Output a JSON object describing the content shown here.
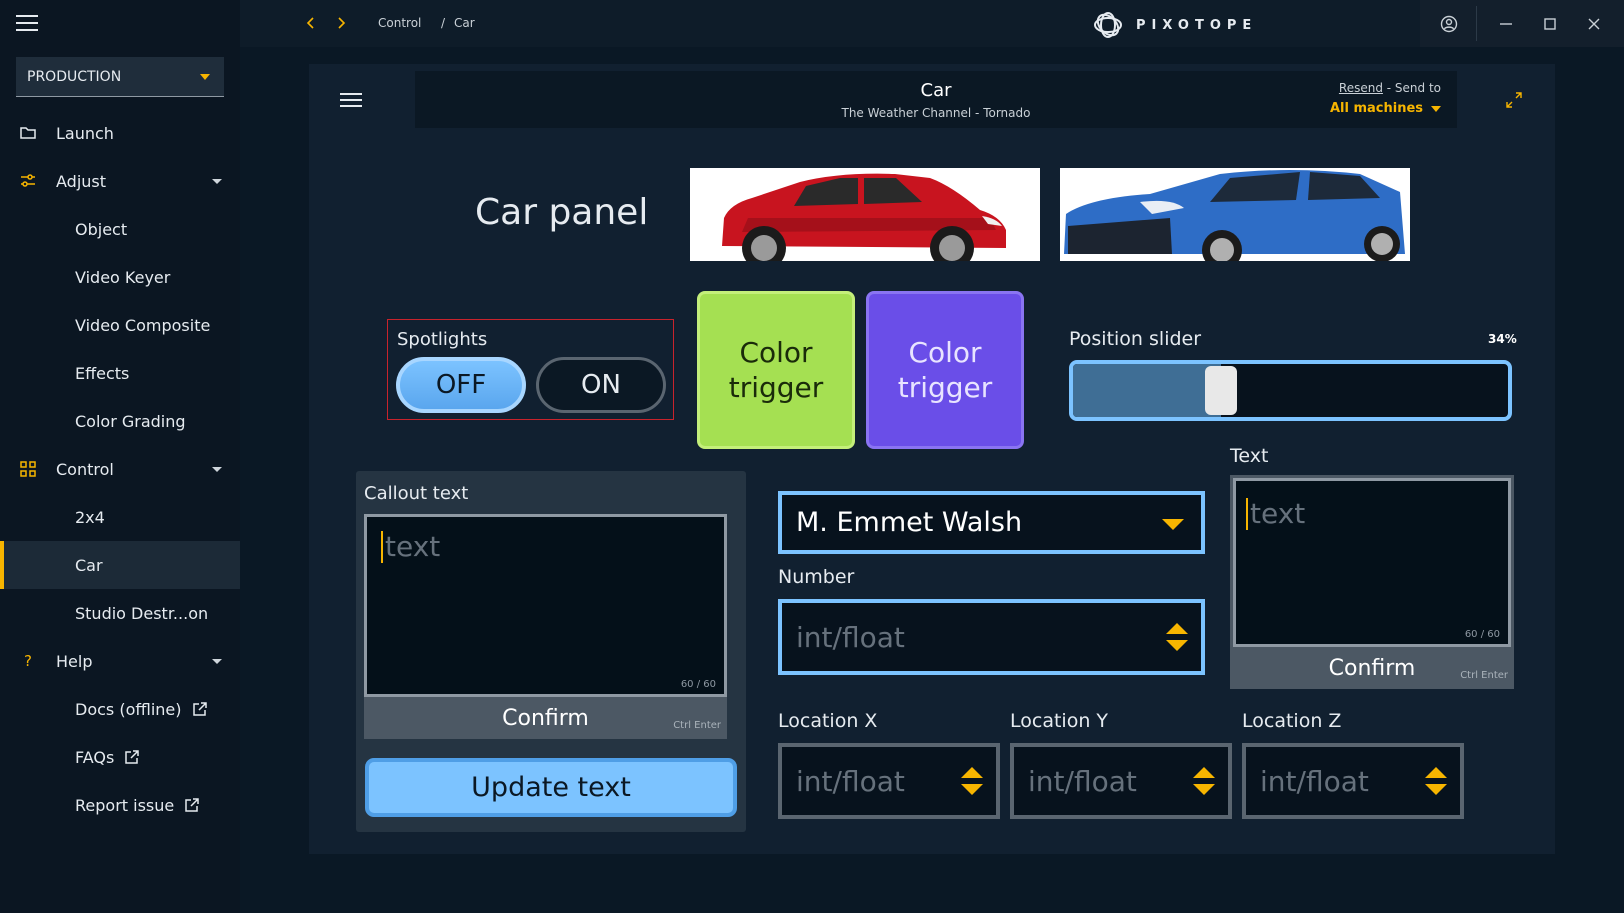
{
  "app": {
    "brand": "PIXOTOPE"
  },
  "sidebar": {
    "environment": "PRODUCTION",
    "items": [
      {
        "label": "Launch"
      },
      {
        "label": "Adjust"
      },
      {
        "label": "Object"
      },
      {
        "label": "Video Keyer"
      },
      {
        "label": "Video Composite"
      },
      {
        "label": "Effects"
      },
      {
        "label": "Color Grading"
      },
      {
        "label": "Control"
      },
      {
        "label": "2x4"
      },
      {
        "label": "Car"
      },
      {
        "label": "Studio Destr...on"
      },
      {
        "label": "Help"
      },
      {
        "label": "Docs (offline)"
      },
      {
        "label": "FAQs"
      },
      {
        "label": "Report issue"
      }
    ]
  },
  "breadcrumb": {
    "part1": "Control",
    "separator": "/",
    "part2": "Car"
  },
  "header": {
    "title": "Car",
    "subtitle": "The Weather Channel - Tornado",
    "resend": "Resend",
    "send_to": " - Send to",
    "machines": "All machines"
  },
  "panel": {
    "title": "Car panel",
    "spotlights": {
      "label": "Spotlights",
      "off": "OFF",
      "on": "ON",
      "state": "OFF"
    },
    "color_trigger_1": {
      "line1": "Color",
      "line2": "trigger",
      "color": "#a5e052"
    },
    "color_trigger_2": {
      "line1": "Color",
      "line2": "trigger",
      "color": "#6a4ee8"
    },
    "slider": {
      "label": "Position slider",
      "value_text": "34%",
      "value": 0.34
    },
    "callout": {
      "label": "Callout text",
      "placeholder": "text",
      "count": "60 / 60",
      "confirm": "Confirm",
      "shortcut": "Ctrl Enter"
    },
    "update_button": "Update text",
    "select": {
      "value": "M. Emmet Walsh"
    },
    "number": {
      "label": "Number",
      "placeholder": "int/float"
    },
    "text": {
      "label": "Text",
      "placeholder": "text",
      "count": "60 / 60",
      "confirm": "Confirm",
      "shortcut": "Ctrl Enter"
    },
    "location_x": {
      "label": "Location X",
      "placeholder": "int/float"
    },
    "location_y": {
      "label": "Location Y",
      "placeholder": "int/float"
    },
    "location_z": {
      "label": "Location Z",
      "placeholder": "int/float"
    }
  },
  "colors": {
    "accent": "#f7b500",
    "highlight_blue": "#7cc3ff",
    "spotlight_border": "#c8232c"
  }
}
